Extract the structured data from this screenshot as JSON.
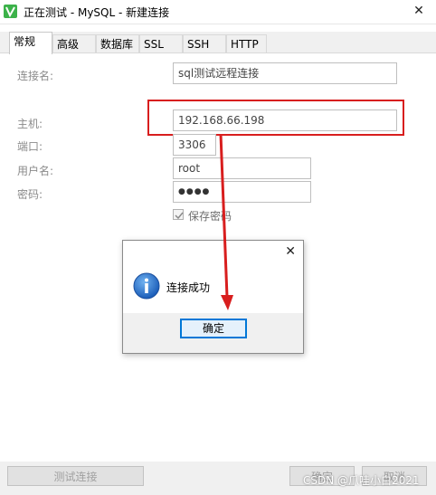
{
  "window": {
    "title": "正在测试 - MySQL - 新建连接",
    "close_glyph": "✕"
  },
  "tabs": [
    {
      "label": "常规",
      "active": true
    },
    {
      "label": "高级",
      "active": false
    },
    {
      "label": "数据库",
      "active": false
    },
    {
      "label": "SSL",
      "active": false
    },
    {
      "label": "SSH",
      "active": false
    },
    {
      "label": "HTTP",
      "active": false
    }
  ],
  "form": {
    "connection_name": {
      "label": "连接名:",
      "value": "sql测试远程连接"
    },
    "host": {
      "label": "主机:",
      "value": "192.168.66.198"
    },
    "port": {
      "label": "端口:",
      "value": "3306"
    },
    "username": {
      "label": "用户名:",
      "value": "root"
    },
    "password": {
      "label": "密码:",
      "value": "●●●●"
    },
    "save_password": {
      "label": "保存密码",
      "checked": true
    }
  },
  "buttons": {
    "test_connection": "测试连接",
    "ok": "确定",
    "cancel": "取消"
  },
  "dialog": {
    "message": "连接成功",
    "ok": "确定",
    "close_glyph": "✕"
  },
  "watermark": "CSDN @爪哇小白2021",
  "colors": {
    "highlight_red": "#d81e1e",
    "accent_blue": "#0078d7",
    "app_green": "#3cb24a"
  }
}
